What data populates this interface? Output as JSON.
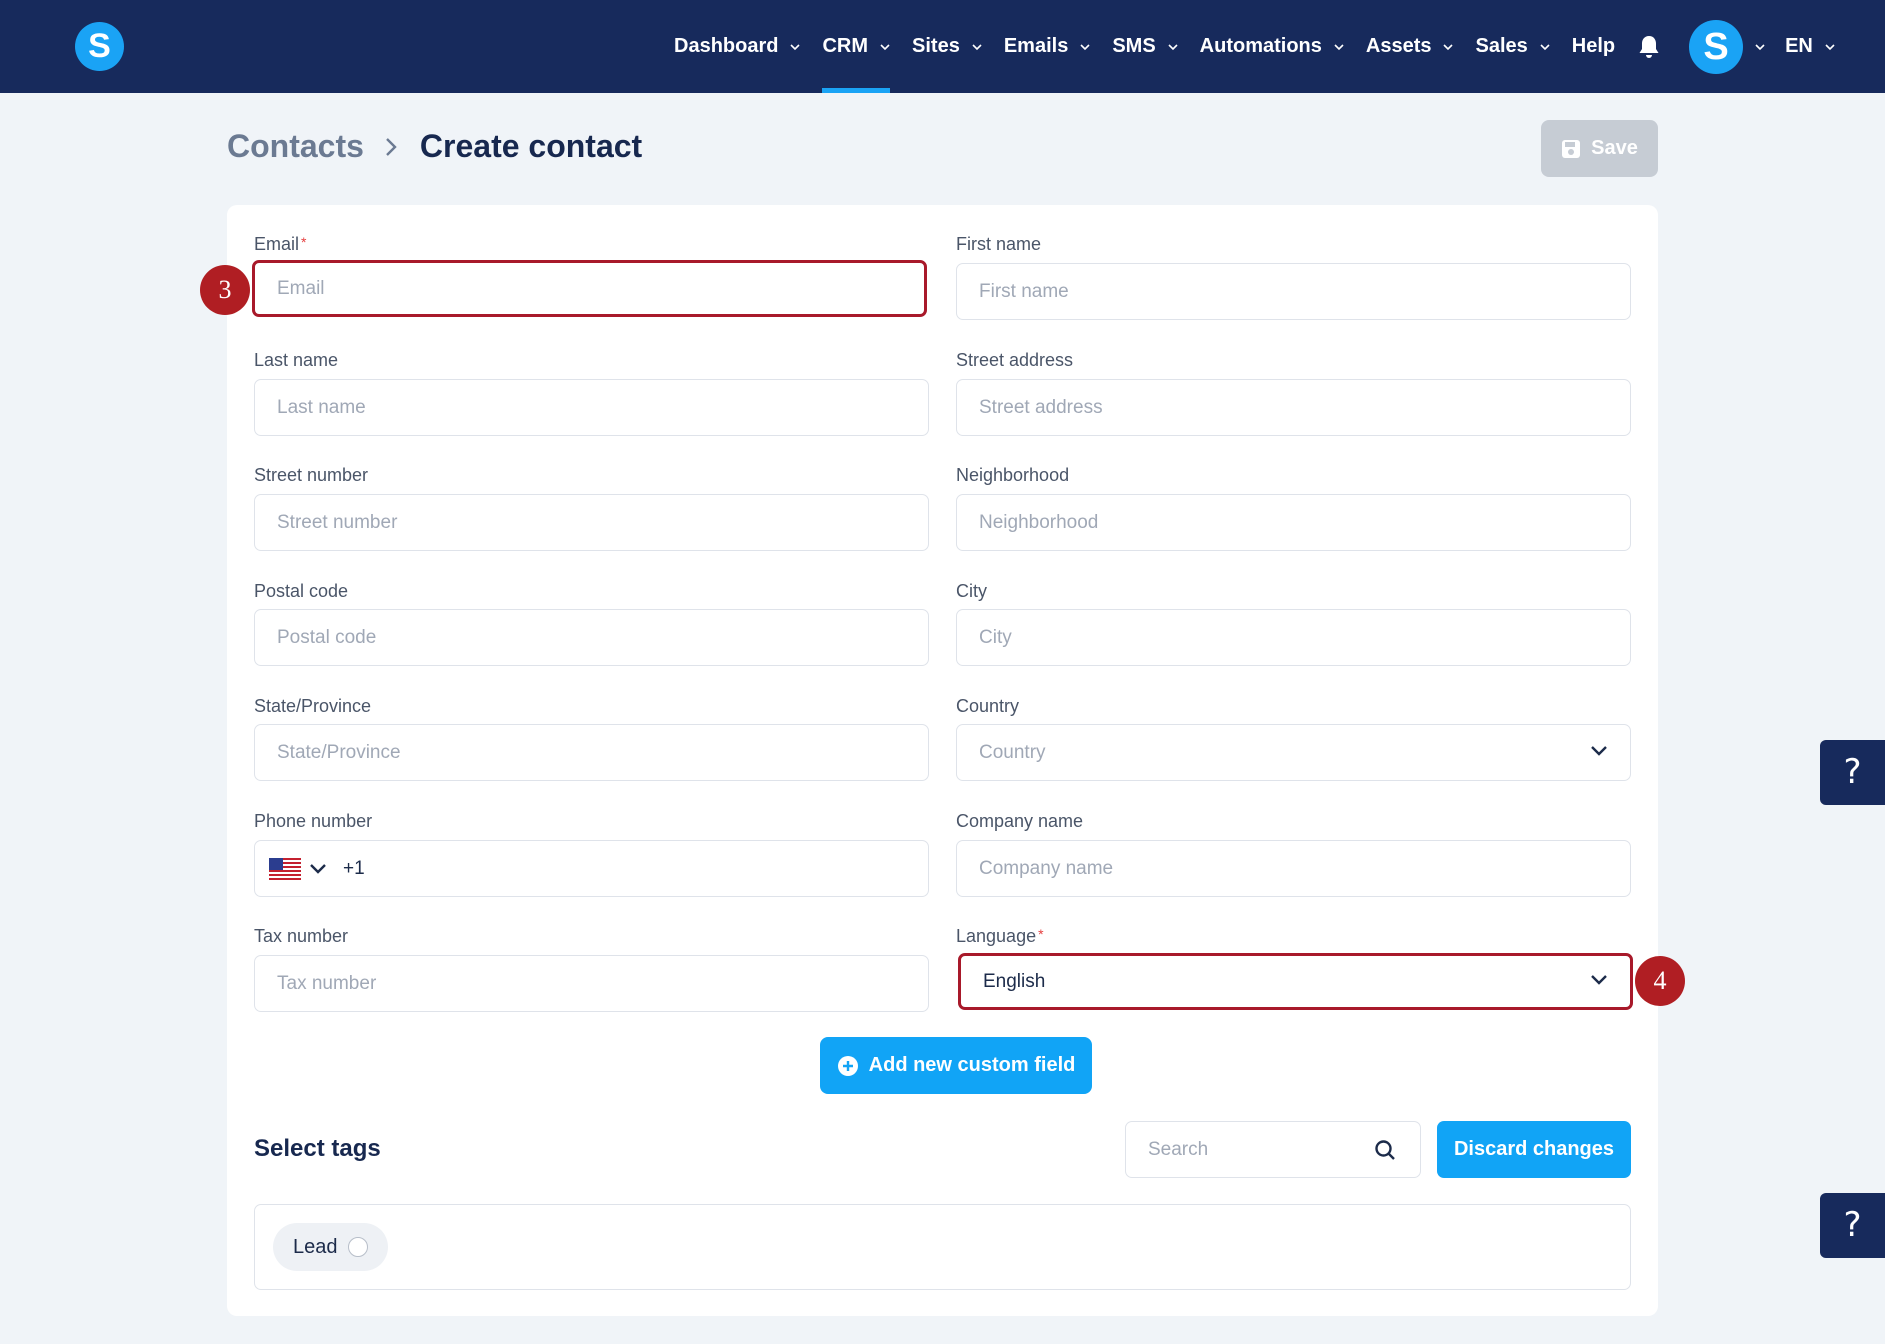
{
  "nav": {
    "logo_letter": "S",
    "items": [
      {
        "label": "Dashboard"
      },
      {
        "label": "CRM"
      },
      {
        "label": "Sites"
      },
      {
        "label": "Emails"
      },
      {
        "label": "SMS"
      },
      {
        "label": "Automations"
      },
      {
        "label": "Assets"
      },
      {
        "label": "Sales"
      },
      {
        "label": "Help"
      }
    ],
    "active_item": "CRM",
    "avatar_letter": "S",
    "language": "EN"
  },
  "header": {
    "breadcrumb_parent": "Contacts",
    "breadcrumb_current": "Create contact",
    "save_label": "Save"
  },
  "form": {
    "email": {
      "label": "Email",
      "required_mark": "*",
      "placeholder": "Email"
    },
    "first_name": {
      "label": "First name",
      "placeholder": "First name"
    },
    "last_name": {
      "label": "Last name",
      "placeholder": "Last name"
    },
    "street_address": {
      "label": "Street address",
      "placeholder": "Street address"
    },
    "street_number": {
      "label": "Street number",
      "placeholder": "Street number"
    },
    "neighborhood": {
      "label": "Neighborhood",
      "placeholder": "Neighborhood"
    },
    "postal_code": {
      "label": "Postal code",
      "placeholder": "Postal code"
    },
    "city": {
      "label": "City",
      "placeholder": "City"
    },
    "state": {
      "label": "State/Province",
      "placeholder": "State/Province"
    },
    "country": {
      "label": "Country",
      "placeholder": "Country"
    },
    "phone": {
      "label": "Phone number",
      "dial_code": "+1"
    },
    "company": {
      "label": "Company name",
      "placeholder": "Company name"
    },
    "tax_number": {
      "label": "Tax number",
      "placeholder": "Tax number"
    },
    "language": {
      "label": "Language",
      "required_mark": "*",
      "value": "English"
    }
  },
  "add_custom_field_label": "Add new custom field",
  "tags": {
    "title": "Select tags",
    "search_placeholder": "Search",
    "discard_label": "Discard changes",
    "items": [
      {
        "label": "Lead"
      }
    ]
  },
  "annotations": {
    "email_marker": "3",
    "language_marker": "4"
  },
  "help": {
    "label": "?"
  },
  "colors": {
    "nav_bg": "#172a5c",
    "accent": "#11a4f6",
    "highlight": "#a8192a",
    "marker": "#b01e23"
  }
}
